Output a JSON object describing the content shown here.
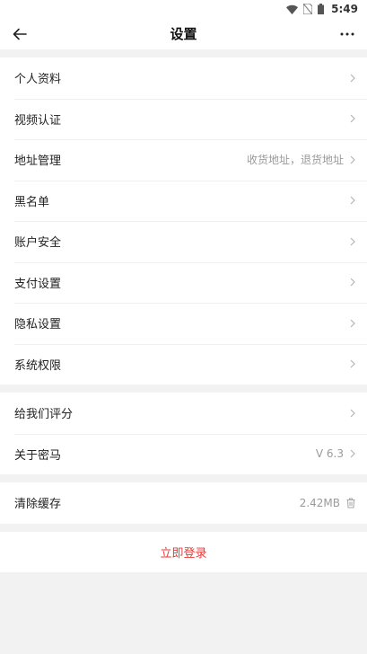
{
  "status_bar": {
    "time": "5:49"
  },
  "header": {
    "title": "设置",
    "back_icon": "arrow-left-icon",
    "more_icon": "more-dots-icon"
  },
  "group1": [
    {
      "label": "个人资料",
      "value": ""
    },
    {
      "label": "视频认证",
      "value": ""
    },
    {
      "label": "地址管理",
      "value": "收货地址，退货地址"
    },
    {
      "label": "黑名单",
      "value": ""
    },
    {
      "label": "账户安全",
      "value": ""
    },
    {
      "label": "支付设置",
      "value": ""
    },
    {
      "label": "隐私设置",
      "value": ""
    },
    {
      "label": "系统权限",
      "value": ""
    }
  ],
  "group2": [
    {
      "label": "给我们评分",
      "value": ""
    },
    {
      "label": "关于密马",
      "value": "V 6.3"
    }
  ],
  "cache": {
    "label": "清除缓存",
    "value": "2.42MB",
    "icon": "trash-icon"
  },
  "login": {
    "label": "立即登录"
  },
  "colors": {
    "accent": "#e83a3a",
    "background": "#f2f2f2",
    "muted": "#9a9a9a"
  }
}
